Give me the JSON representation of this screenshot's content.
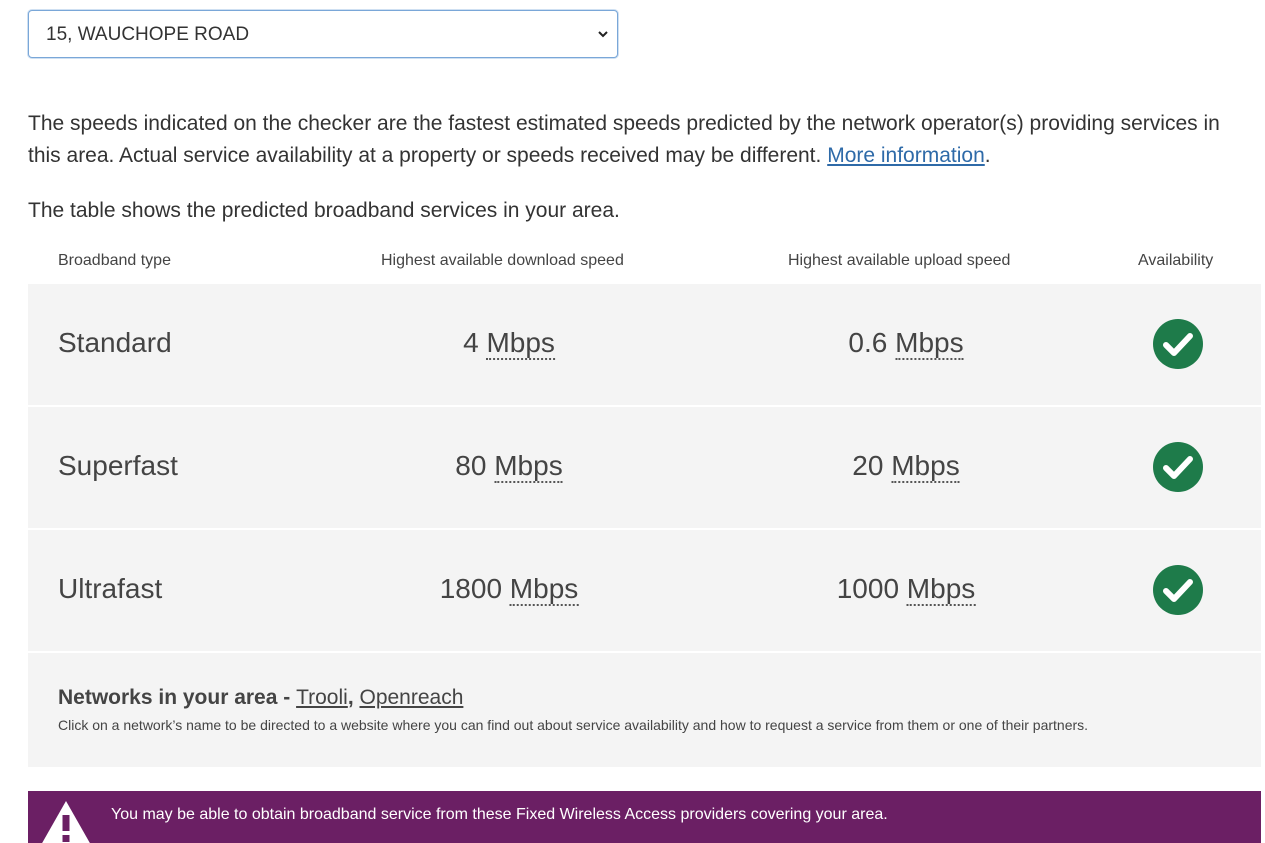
{
  "address_select": {
    "selected": "15, WAUCHOPE ROAD",
    "icon": "chevron-down-icon"
  },
  "intro": {
    "text": "The speeds indicated on the checker are the fastest estimated speeds predicted by the network operator(s) providing services in this area. Actual service availability at a property or speeds received may be different. ",
    "link": "More information",
    "after": "."
  },
  "table_intro": "The table shows the predicted broadband services in your area.",
  "table": {
    "headers": {
      "type": "Broadband type",
      "download": "Highest available download speed",
      "upload": "Highest available upload speed",
      "availability": "Availability"
    },
    "rows": [
      {
        "type": "Standard",
        "download_value": "4",
        "upload_value": "0.6",
        "unit": "Mbps",
        "available_icon": "check-circle-icon"
      },
      {
        "type": "Superfast",
        "download_value": "80",
        "upload_value": "20",
        "unit": "Mbps",
        "available_icon": "check-circle-icon"
      },
      {
        "type": "Ultrafast",
        "download_value": "1800",
        "upload_value": "1000",
        "unit": "Mbps",
        "available_icon": "check-circle-icon"
      }
    ]
  },
  "networks": {
    "title": "Networks in your area - ",
    "links": [
      "Trooli",
      "Openreach"
    ],
    "separator": ", ",
    "note": "Click on a network’s name to be directed to a website where you can find out about service availability and how to request a service from them or one of their partners."
  },
  "fwa_banner": {
    "text": "You may be able to obtain broadband service from these Fixed Wireless Access providers covering your area.",
    "icon": "warning-icon"
  },
  "colors": {
    "check_green": "#1e7b4a",
    "banner_purple": "#6b1f64",
    "link_blue": "#2e6aa8",
    "row_bg": "#f4f4f4"
  }
}
